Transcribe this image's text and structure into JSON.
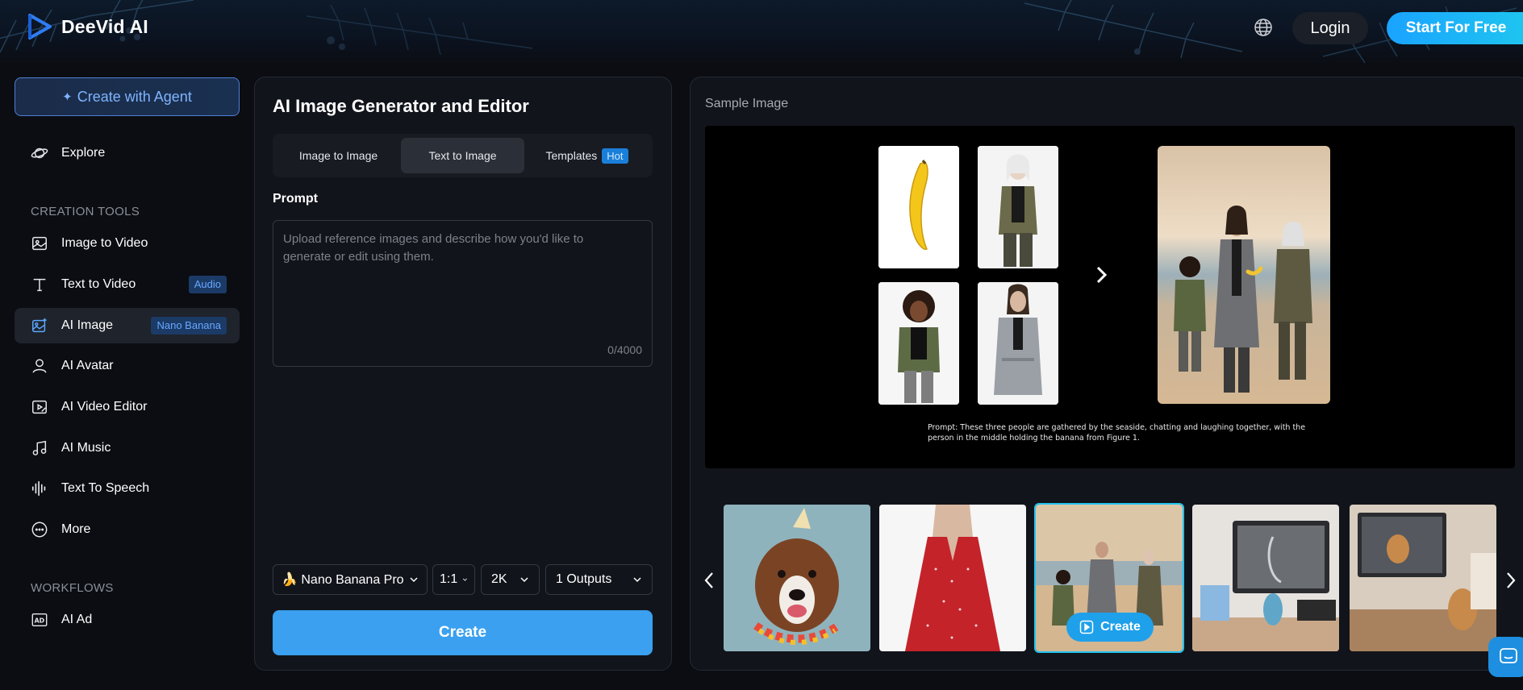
{
  "header": {
    "brand": "DeeVid AI",
    "login_label": "Login",
    "start_label": "Start For Free"
  },
  "sidebar": {
    "agent_label": "Create with Agent",
    "explore_label": "Explore",
    "creation_tools_heading": "CREATION TOOLS",
    "items": [
      {
        "label": "Image to Video",
        "icon": "image-icon"
      },
      {
        "label": "Text to Video",
        "icon": "text-icon",
        "badge": "Audio"
      },
      {
        "label": "AI Image",
        "icon": "ai-image-icon",
        "badge": "Nano Banana",
        "active": true
      },
      {
        "label": "AI Avatar",
        "icon": "avatar-icon"
      },
      {
        "label": "AI Video Editor",
        "icon": "video-editor-icon"
      },
      {
        "label": "AI Music",
        "icon": "music-icon"
      },
      {
        "label": "Text To Speech",
        "icon": "waveform-icon"
      },
      {
        "label": "More",
        "icon": "more-icon"
      }
    ],
    "workflows_heading": "WORKFLOWS",
    "workflow_items": [
      {
        "label": "AI Ad",
        "icon": "ad-icon"
      }
    ]
  },
  "generator": {
    "title": "AI Image Generator and Editor",
    "tabs": [
      {
        "label": "Image to Image"
      },
      {
        "label": "Text to Image",
        "active": true
      },
      {
        "label": "Templates",
        "badge": "Hot"
      }
    ],
    "prompt_label": "Prompt",
    "prompt_placeholder": "Upload reference images and describe how you'd like to generate or edit using them.",
    "prompt_count": "0/4000",
    "model_label": "🍌 Nano Banana Pro",
    "ratio_label": "1:1",
    "resolution_label": "2K",
    "outputs_label": "1 Outputs",
    "create_label": "Create"
  },
  "sample": {
    "heading": "Sample Image",
    "caption": "Prompt: These three people are gathered by the seaside, chatting and laughing together, with the person in the middle holding the banana from Figure 1.",
    "thumb_create_label": "Create"
  },
  "colors": {
    "accent": "#3aa0ef",
    "brand_gradient_start": "#1aa3ff",
    "badge_bg": "#1b3a66",
    "badge_text": "#67a8ff",
    "active_thumb_border": "#22c4f0"
  }
}
